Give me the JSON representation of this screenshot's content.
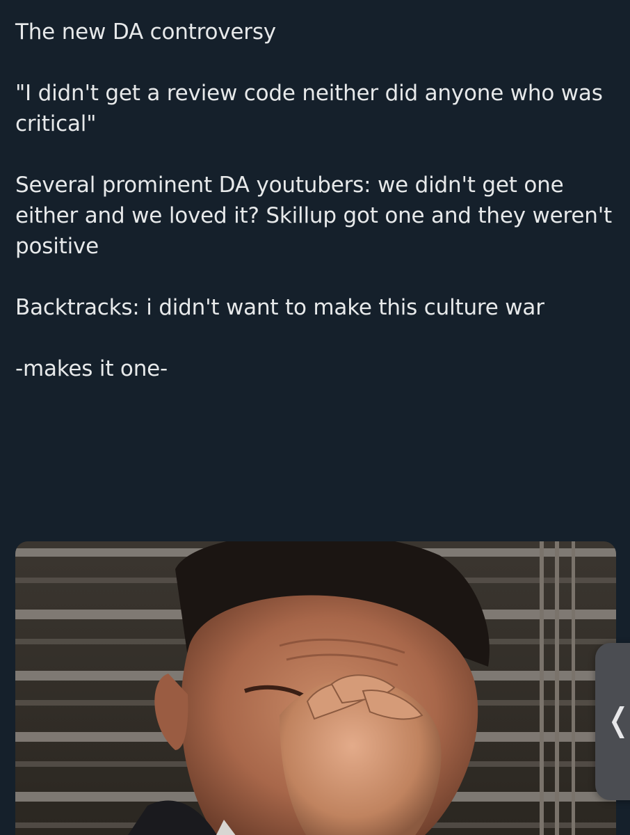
{
  "tweet": {
    "paragraphs": [
      "The new DA controversy",
      "\"I didn't get a review code neither did anyone who was critical\"",
      "Several prominent DA youtubers: we didn't get one either and we loved it? Skillup got one and they weren't positive",
      "Backtracks: i didn't want to make this culture war",
      "-makes it one-"
    ]
  },
  "media": {
    "alt_icon": "gif-image"
  },
  "side_tab": {
    "icon": "chevron-left-icon",
    "glyph": "❬"
  },
  "colors": {
    "background": "#15202b",
    "text": "#e7e9ea",
    "side_tab": "#4b4d52"
  }
}
